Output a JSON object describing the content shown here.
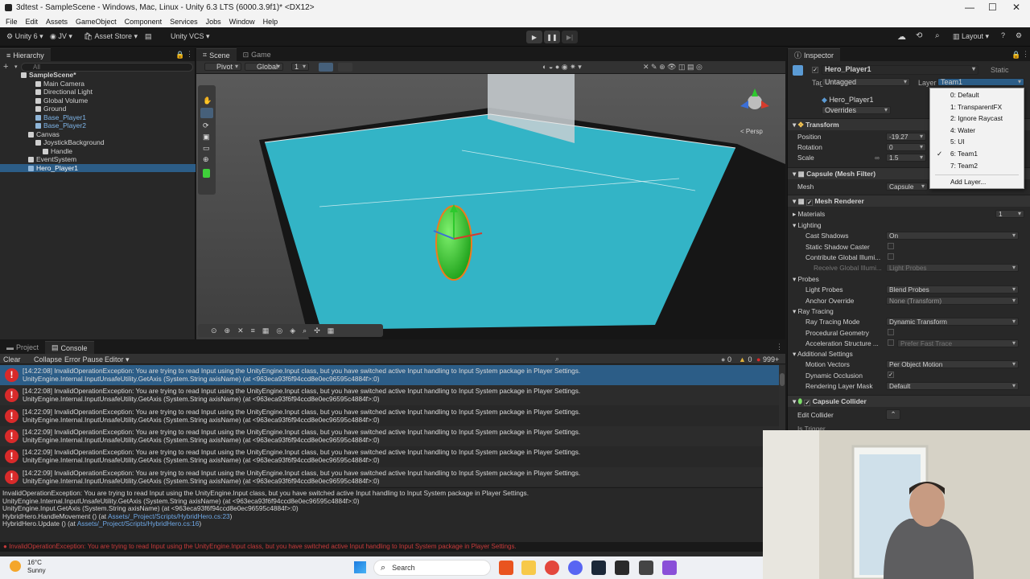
{
  "window": {
    "title": "3dtest - SampleScene - Windows, Mac, Linux - Unity 6.3 LTS (6000.3.9f1)* <DX12>",
    "minimize": "—",
    "maximize": "☐",
    "close": "✕"
  },
  "menu": [
    "File",
    "Edit",
    "Assets",
    "GameObject",
    "Component",
    "Services",
    "Jobs",
    "Window",
    "Help"
  ],
  "toolbar": {
    "account": "Unity 6",
    "user": "JV",
    "asset_store": "Asset Store",
    "vcs": "Unity VCS",
    "layout": "Layout"
  },
  "hierarchy": {
    "tab": "Hierarchy",
    "search_placeholder": "All",
    "items": [
      {
        "label": "SampleScene*",
        "depth": 0,
        "icon": "unity-scene-icon",
        "blue": false,
        "selected": false,
        "bold": true
      },
      {
        "label": "Main Camera",
        "depth": 2,
        "icon": "gameobject-icon",
        "blue": false,
        "selected": false
      },
      {
        "label": "Directional Light",
        "depth": 2,
        "icon": "gameobject-icon",
        "blue": false,
        "selected": false
      },
      {
        "label": "Global Volume",
        "depth": 2,
        "icon": "gameobject-icon",
        "blue": false,
        "selected": false
      },
      {
        "label": "Ground",
        "depth": 2,
        "icon": "gameobject-icon",
        "blue": false,
        "selected": false
      },
      {
        "label": "Base_Player1",
        "depth": 2,
        "icon": "prefab-icon",
        "blue": true,
        "selected": false
      },
      {
        "label": "Base_Player2",
        "depth": 2,
        "icon": "prefab-icon",
        "blue": true,
        "selected": false
      },
      {
        "label": "Canvas",
        "depth": 1,
        "icon": "gameobject-icon",
        "blue": false,
        "selected": false
      },
      {
        "label": "JoystickBackground",
        "depth": 2,
        "icon": "gameobject-icon",
        "blue": false,
        "selected": false
      },
      {
        "label": "Handle",
        "depth": 3,
        "icon": "gameobject-icon",
        "blue": false,
        "selected": false
      },
      {
        "label": "EventSystem",
        "depth": 1,
        "icon": "gameobject-icon",
        "blue": false,
        "selected": false
      },
      {
        "label": "Hero_Player1",
        "depth": 1,
        "icon": "prefab-icon",
        "blue": true,
        "selected": true
      }
    ]
  },
  "scene": {
    "tabs": [
      "Scene",
      "Game"
    ],
    "pivot": "Pivot",
    "global": "Global",
    "grid_value": "1",
    "persp": "< Persp"
  },
  "inspector": {
    "tab": "Inspector",
    "object_name": "Hero_Player1",
    "static_label": "Static",
    "tag_label": "Tag",
    "tag_value": "Untagged",
    "layer_label": "Layer",
    "layer_value": "Team1",
    "prefab_name": "Hero_Player1",
    "overrides": "Overrides",
    "transform": {
      "title": "Transform",
      "position_label": "Position",
      "position_x": "-19.27",
      "rotation_label": "Rotation",
      "rotation_x": "0",
      "scale_label": "Scale",
      "scale_x": "1.5"
    },
    "mesh_filter": {
      "title": "Capsule (Mesh Filter)",
      "mesh_label": "Mesh",
      "mesh_value": "Capsule"
    },
    "mesh_renderer": {
      "title": "Mesh Renderer",
      "materials_label": "Materials",
      "materials_count": "1",
      "lighting": "Lighting",
      "cast_shadows_label": "Cast Shadows",
      "cast_shadows": "On",
      "static_shadow": "Static Shadow Caster",
      "contribute_gi": "Contribute Global Illumi...",
      "receive_gi": "Receive Global Illumi...",
      "receive_gi_value": "Light Probes",
      "probes": "Probes",
      "light_probes_label": "Light Probes",
      "light_probes": "Blend Probes",
      "anchor_label": "Anchor Override",
      "anchor": "None (Transform)",
      "ray_tracing": "Ray Tracing",
      "rt_mode_label": "Ray Tracing Mode",
      "rt_mode": "Dynamic Transform",
      "proc_geo": "Procedural Geometry",
      "accel_label": "Acceleration Structure ...",
      "accel": "Prefer Fast Trace",
      "additional": "Additional Settings",
      "motion_label": "Motion Vectors",
      "motion": "Per Object Motion",
      "dyn_occ": "Dynamic Occlusion",
      "render_layer_label": "Rendering Layer Mask",
      "render_layer": "Default"
    },
    "capsule_collider": {
      "title": "Capsule Collider",
      "edit_collider": "Edit Collider",
      "is_trigger": "Is Trigger"
    }
  },
  "layer_menu": {
    "items": [
      "0: Default",
      "1: TransparentFX",
      "2: Ignore Raycast",
      "4: Water",
      "5: UI",
      "6: Team1",
      "7: Team2"
    ],
    "checked": "6: Team1",
    "add": "Add Layer..."
  },
  "console": {
    "tabs": [
      "Project",
      "Console"
    ],
    "clear": "Clear",
    "collapse": "Collapse",
    "error_pause": "Error Pause",
    "editor": "Editor",
    "counts": {
      "warn": "0",
      "info": "0",
      "error": "999+"
    },
    "entries": [
      {
        "l1": "[14:22:08] InvalidOperationException: You are trying to read Input using the UnityEngine.Input class, but you have switched active Input handling to Input System package in Player Settings.",
        "l2": "UnityEngine.Internal.InputUnsafeUtility.GetAxis (System.String axisName) (at <963eca93f6f94ccd8e0ec96595c4884f>:0)"
      },
      {
        "l1": "[14:22:08] InvalidOperationException: You are trying to read Input using the UnityEngine.Input class, but you have switched active Input handling to Input System package in Player Settings.",
        "l2": "UnityEngine.Internal.InputUnsafeUtility.GetAxis (System.String axisName) (at <963eca93f6f94ccd8e0ec96595c4884f>:0)"
      },
      {
        "l1": "[14:22:09] InvalidOperationException: You are trying to read Input using the UnityEngine.Input class, but you have switched active Input handling to Input System package in Player Settings.",
        "l2": "UnityEngine.Internal.InputUnsafeUtility.GetAxis (System.String axisName) (at <963eca93f6f94ccd8e0ec96595c4884f>:0)"
      },
      {
        "l1": "[14:22:09] InvalidOperationException: You are trying to read Input using the UnityEngine.Input class, but you have switched active Input handling to Input System package in Player Settings.",
        "l2": "UnityEngine.Internal.InputUnsafeUtility.GetAxis (System.String axisName) (at <963eca93f6f94ccd8e0ec96595c4884f>:0)"
      },
      {
        "l1": "[14:22:09] InvalidOperationException: You are trying to read Input using the UnityEngine.Input class, but you have switched active Input handling to Input System package in Player Settings.",
        "l2": "UnityEngine.Internal.InputUnsafeUtility.GetAxis (System.String axisName) (at <963eca93f6f94ccd8e0ec96595c4884f>:0)"
      },
      {
        "l1": "[14:22:09] InvalidOperationException: You are trying to read Input using the UnityEngine.Input class, but you have switched active Input handling to Input System package in Player Settings.",
        "l2": "UnityEngine.Internal.InputUnsafeUtility.GetAxis (System.String axisName) (at <963eca93f6f94ccd8e0ec96595c4884f>:0)"
      }
    ],
    "detail": [
      "InvalidOperationException: You are trying to read Input using the UnityEngine.Input class, but you have switched active Input handling to Input System package in Player Settings.",
      "UnityEngine.Internal.InputUnsafeUtility.GetAxis (System.String axisName) (at <963eca93f6f94ccd8e0ec96595c4884f>:0)",
      "UnityEngine.Input.GetAxis (System.String axisName) (at <963eca93f6f94ccd8e0ec96595c4884f>:0)",
      "HybridHero.HandleMovement () (at ",
      "Assets/_Project/Scripts/HybridHero.cs:23",
      ")",
      "HybridHero.Update () (at ",
      "Assets/_Project/Scripts/HybridHero.cs:16",
      ")"
    ],
    "status": "InvalidOperationException: You are trying to read Input using the UnityEngine.Input class, but you have switched active Input handling to Input System package in Player Settings."
  },
  "taskbar": {
    "temp": "16°C",
    "weather": "Sunny",
    "search": "Search"
  },
  "colors": {
    "selection": "#2c5d87",
    "ground": "#33b4c6",
    "capsule": "#3fd13a",
    "error": "#d82a2a"
  }
}
